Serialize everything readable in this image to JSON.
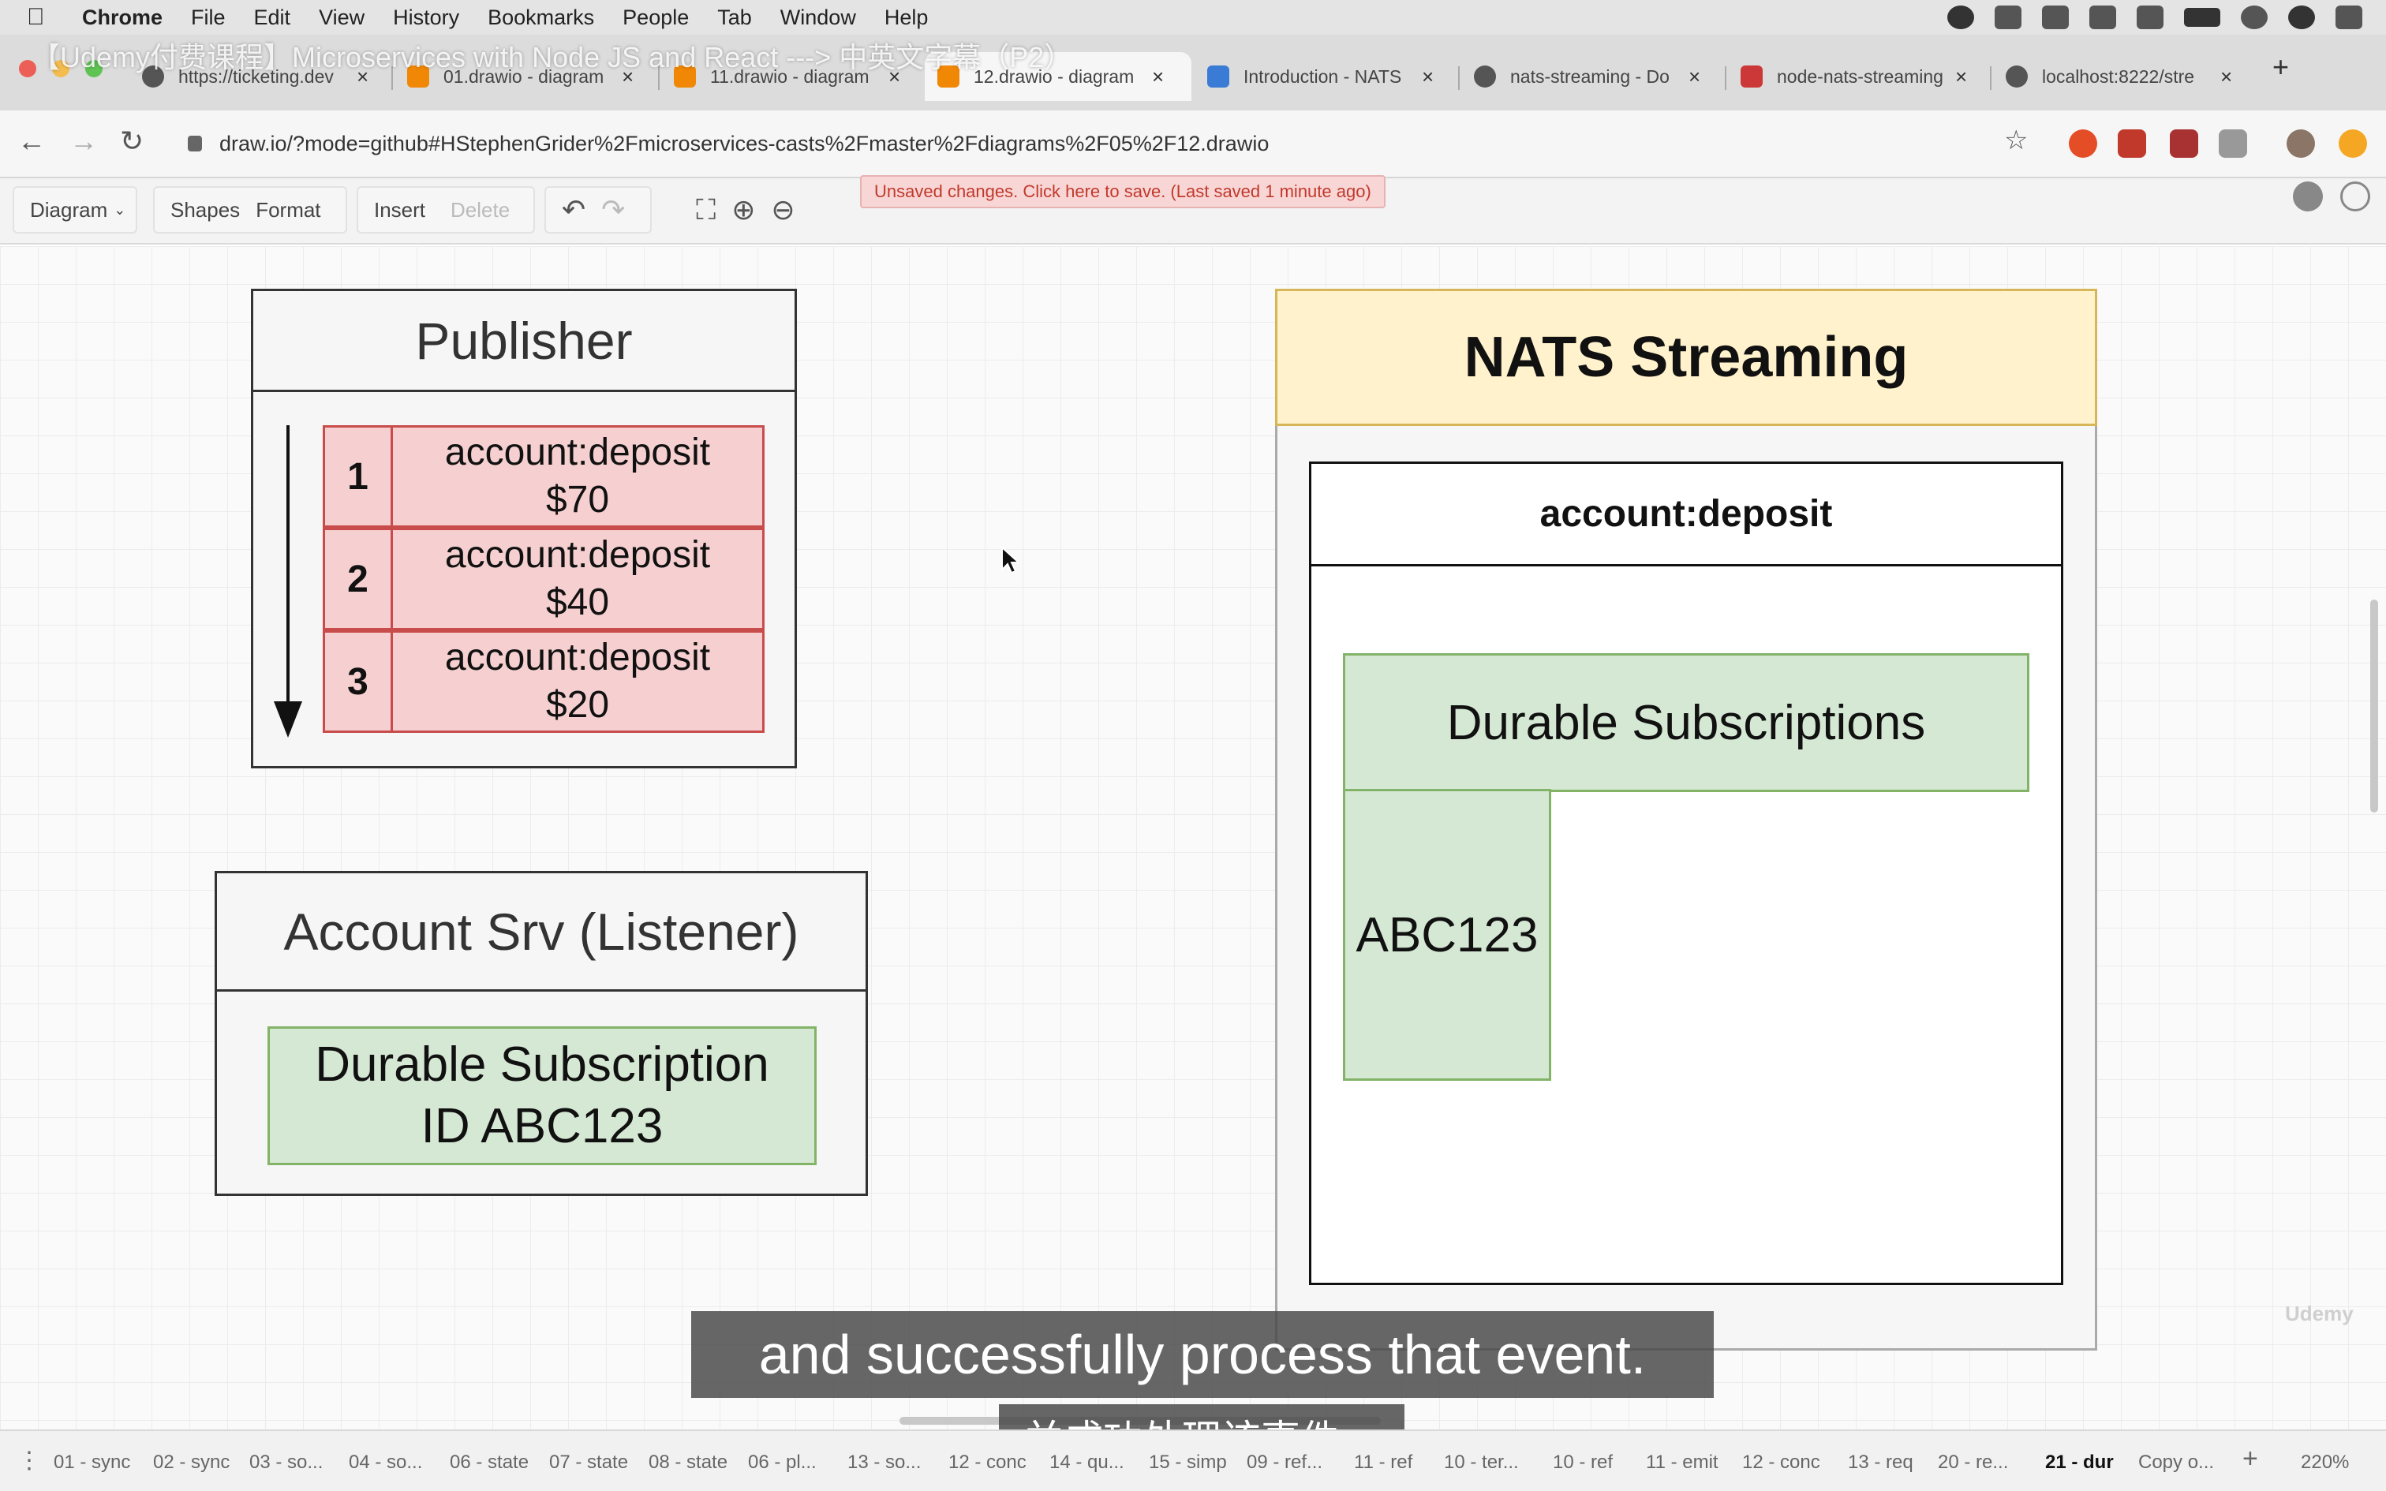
{
  "menubar": {
    "app": "Chrome",
    "items": [
      "File",
      "Edit",
      "View",
      "History",
      "Bookmarks",
      "People",
      "Tab",
      "Window",
      "Help"
    ]
  },
  "browser": {
    "overlay_title": "【Udemy付费课程】Microservices with Node JS and React ---> 中英文字幕（P2）",
    "tabs": [
      {
        "label": "https://ticketing.dev",
        "favicon_color": "#555555"
      },
      {
        "label": "01.drawio - diagram",
        "favicon_color": "#f08705"
      },
      {
        "label": "11.drawio - diagram",
        "favicon_color": "#f08705"
      },
      {
        "label": "12.drawio - diagram",
        "favicon_color": "#f08705"
      },
      {
        "label": "Introduction - NATS",
        "favicon_color": "#3a7bd5"
      },
      {
        "label": "nats-streaming - Do",
        "favicon_color": "#555555"
      },
      {
        "label": "node-nats-streaming",
        "favicon_color": "#cb3837"
      },
      {
        "label": "localhost:8222/stre",
        "favicon_color": "#555555"
      }
    ],
    "active_tab_index": 3,
    "url": "draw.io/?mode=github#HStephenGrider%2Fmicroservices-casts%2Fmaster%2Fdiagrams%2F05%2F12.drawio"
  },
  "toolbar": {
    "diagram": "Diagram",
    "shapes": "Shapes",
    "format": "Format",
    "insert": "Insert",
    "delete": "Delete",
    "unsaved": "Unsaved changes. Click here to save. (Last saved 1 minute ago)"
  },
  "diagram": {
    "publisher": {
      "title": "Publisher",
      "events": [
        {
          "num": "1",
          "name": "account:deposit",
          "amount": "$70"
        },
        {
          "num": "2",
          "name": "account:deposit",
          "amount": "$40"
        },
        {
          "num": "3",
          "name": "account:deposit",
          "amount": "$20"
        }
      ]
    },
    "listener": {
      "title": "Account Srv (Listener)",
      "sub_line1": "Durable Subscription",
      "sub_line2": "ID ABC123"
    },
    "nats": {
      "title": "NATS Streaming",
      "channel": "account:deposit",
      "durable": "Durable Subscriptions",
      "id": "ABC123"
    }
  },
  "subtitles": {
    "en": "and successfully process that event.",
    "zh": "并成功处理该事件。"
  },
  "pages": {
    "tabs": [
      "01 - sync",
      "02 - sync",
      "03 - so...",
      "04 - so...",
      "06 - state",
      "07 - state",
      "08 - state",
      "06 - pl...",
      "13 - so...",
      "12 - conc",
      "14 - qu...",
      "15 - simp",
      "09 - ref...",
      "11 - ref",
      "10 - ter...",
      "10 - ref",
      "11 - emit",
      "12 - conc",
      "13 - req",
      "20 - re...",
      "21 - dur",
      "Copy o..."
    ],
    "active": "21 - dur",
    "zoom": "220%"
  },
  "colors": {
    "event_fill": "#f6d0d0",
    "event_stroke": "#c94c4c",
    "green_fill": "#d5e8d4",
    "green_stroke": "#82b366",
    "nats_header": "#fff2cc",
    "nats_header_stroke": "#d6b656"
  }
}
